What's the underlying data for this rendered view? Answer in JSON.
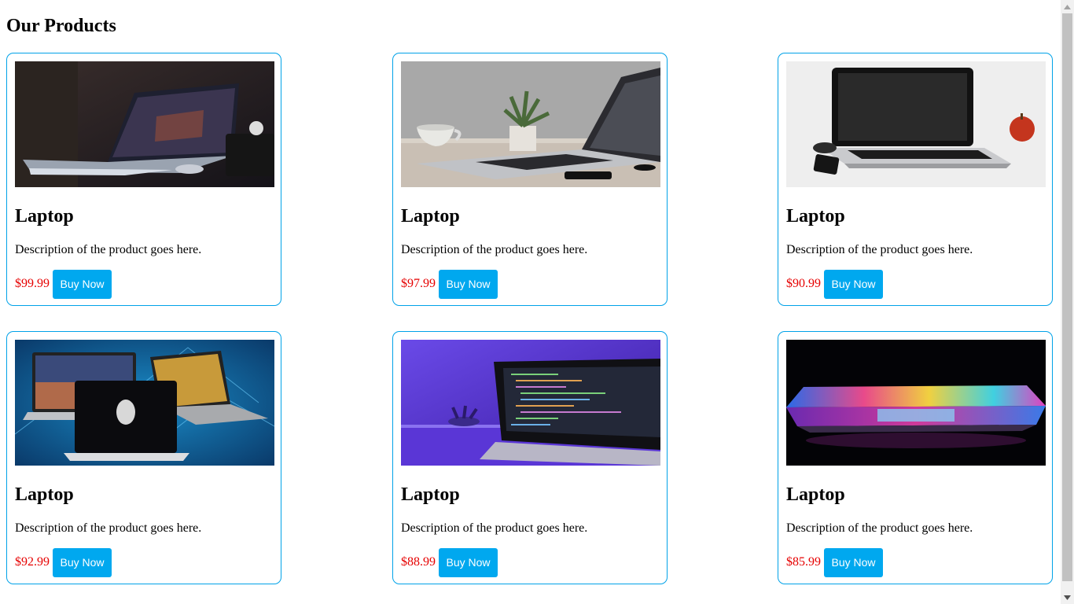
{
  "page": {
    "title": "Our Products"
  },
  "colors": {
    "card_border": "#00a2e8",
    "price": "#e60000",
    "button_bg": "#00a8ef",
    "button_text": "#ffffff"
  },
  "products": [
    {
      "name": "Laptop",
      "description": "Description of the product goes here.",
      "price": "$99.99",
      "button": "Buy Now",
      "image": "dark-desk-laptop-photo"
    },
    {
      "name": "Laptop",
      "description": "Description of the product goes here.",
      "price": "$97.99",
      "button": "Buy Now",
      "image": "laptop-coffee-plant-photo"
    },
    {
      "name": "Laptop",
      "description": "Description of the product goes here.",
      "price": "$90.99",
      "button": "Buy Now",
      "image": "white-laptop-apple-photo"
    },
    {
      "name": "Laptop",
      "description": "Description of the product goes here.",
      "price": "$92.99",
      "button": "Buy Now",
      "image": "gaming-laptops-photo"
    },
    {
      "name": "Laptop",
      "description": "Description of the product goes here.",
      "price": "$88.99",
      "button": "Buy Now",
      "image": "purple-code-laptop-photo"
    },
    {
      "name": "Laptop",
      "description": "Description of the product goes here.",
      "price": "$85.99",
      "button": "Buy Now",
      "image": "rainbow-keyboard-laptop-photo"
    }
  ]
}
